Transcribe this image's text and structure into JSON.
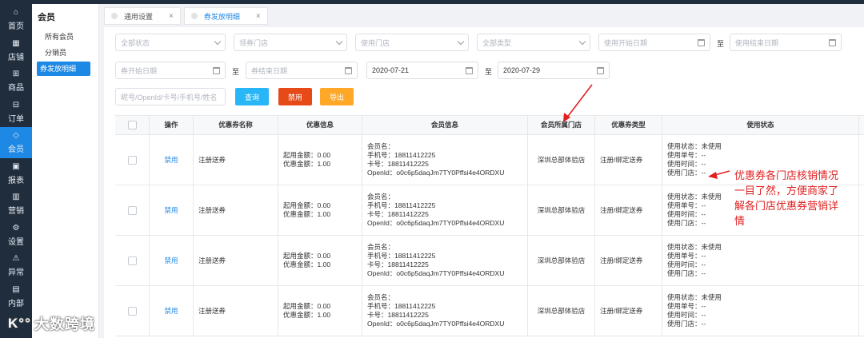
{
  "nav": [
    {
      "label": "首页",
      "icon": "home-icon"
    },
    {
      "label": "店铺",
      "icon": "store-icon"
    },
    {
      "label": "商品",
      "icon": "gift-icon"
    },
    {
      "label": "订单",
      "icon": "order-icon"
    },
    {
      "label": "会员",
      "icon": "diamond-icon",
      "active": true
    },
    {
      "label": "报表",
      "icon": "report-icon"
    },
    {
      "label": "营销",
      "icon": "bar-chart-icon"
    },
    {
      "label": "设置",
      "icon": "gear-icon"
    },
    {
      "label": "异常",
      "icon": "warning-icon"
    },
    {
      "label": "内部",
      "icon": "document-icon"
    }
  ],
  "subnav": {
    "title": "会员",
    "items": [
      {
        "label": "所有会员"
      },
      {
        "label": "分销员"
      },
      {
        "label": "券发放明细",
        "active": true
      }
    ]
  },
  "tabs": [
    {
      "label": "通用设置"
    },
    {
      "label": "券发放明细",
      "active": true
    }
  ],
  "filters": {
    "status": "全部状态",
    "claim_store": "领券门店",
    "use_store": "使用门店",
    "type": "全部类型",
    "use_start": "使用开始日期",
    "use_end": "使用结束日期",
    "coupon_start": "券开始日期",
    "coupon_end": "券结束日期",
    "issue_start": "2020-07-21",
    "issue_end": "2020-07-29",
    "to": "至",
    "search_placeholder": "昵号/OpenId/卡号/手机号/姓名"
  },
  "buttons": {
    "query": "查询",
    "disable": "禁用",
    "export": "导出"
  },
  "table": {
    "headers": [
      "操作",
      "优惠券名称",
      "优惠信息",
      "会员信息",
      "会员所属门店",
      "优惠券类型",
      "使用状态"
    ],
    "rows": [
      {
        "action": "禁用",
        "name": "注册送券",
        "discount": [
          "起用金额：0.00",
          "优惠金额：1.00"
        ],
        "member": [
          "会员名：",
          "手机号：18811412225",
          "卡号：18811412225",
          "OpenId：o0c6p5daqJm7TY0Pffsi4e4ORDXU"
        ],
        "store": "深圳总部体验店",
        "type": "注册/绑定送券",
        "status": [
          "使用状态：未使用",
          "使用单号：--",
          "使用时间：--",
          "使用门店：--"
        ]
      },
      {
        "action": "禁用",
        "name": "注册送券",
        "discount": [
          "起用金额：0.00",
          "优惠金额：1.00"
        ],
        "member": [
          "会员名：",
          "手机号：18811412225",
          "卡号：18811412225",
          "OpenId：o0c6p5daqJm7TY0Pffsi4e4ORDXU"
        ],
        "store": "深圳总部体验店",
        "type": "注册/绑定送券",
        "status": [
          "使用状态：未使用",
          "使用单号：--",
          "使用时间：--",
          "使用门店：--"
        ]
      },
      {
        "action": "禁用",
        "name": "注册送券",
        "discount": [
          "起用金额：0.00",
          "优惠金额：1.00"
        ],
        "member": [
          "会员名：",
          "手机号：18811412225",
          "卡号：18811412225",
          "OpenId：o0c6p5daqJm7TY0Pffsi4e4ORDXU"
        ],
        "store": "深圳总部体验店",
        "type": "注册/绑定送券",
        "status": [
          "使用状态：未使用",
          "使用单号：--",
          "使用时间：--",
          "使用门店：--"
        ]
      },
      {
        "action": "禁用",
        "name": "注册送券",
        "discount": [
          "起用金额：0.00",
          "优惠金额：1.00"
        ],
        "member": [
          "会员名：",
          "手机号：18811412225",
          "卡号：18811412225",
          "OpenId：o0c6p5daqJm7TY0Pffsi4e4ORDXU"
        ],
        "store": "深圳总部体验店",
        "type": "注册/绑定送券",
        "status": [
          "使用状态：未使用",
          "使用单号：--",
          "使用时间：--",
          "使用门店：--"
        ]
      }
    ]
  },
  "annotation": "优惠券各门店核销情况一目了然，方便商家了解各门店优惠券营销详情",
  "watermark": "大数跨境",
  "colors": {
    "nav_bg": "#1f2d3d",
    "accent": "#1e88e5",
    "query_btn": "#29b6f6",
    "disable_btn": "#e64a19",
    "export_btn": "#ffa726",
    "annotation": "#e02020"
  }
}
